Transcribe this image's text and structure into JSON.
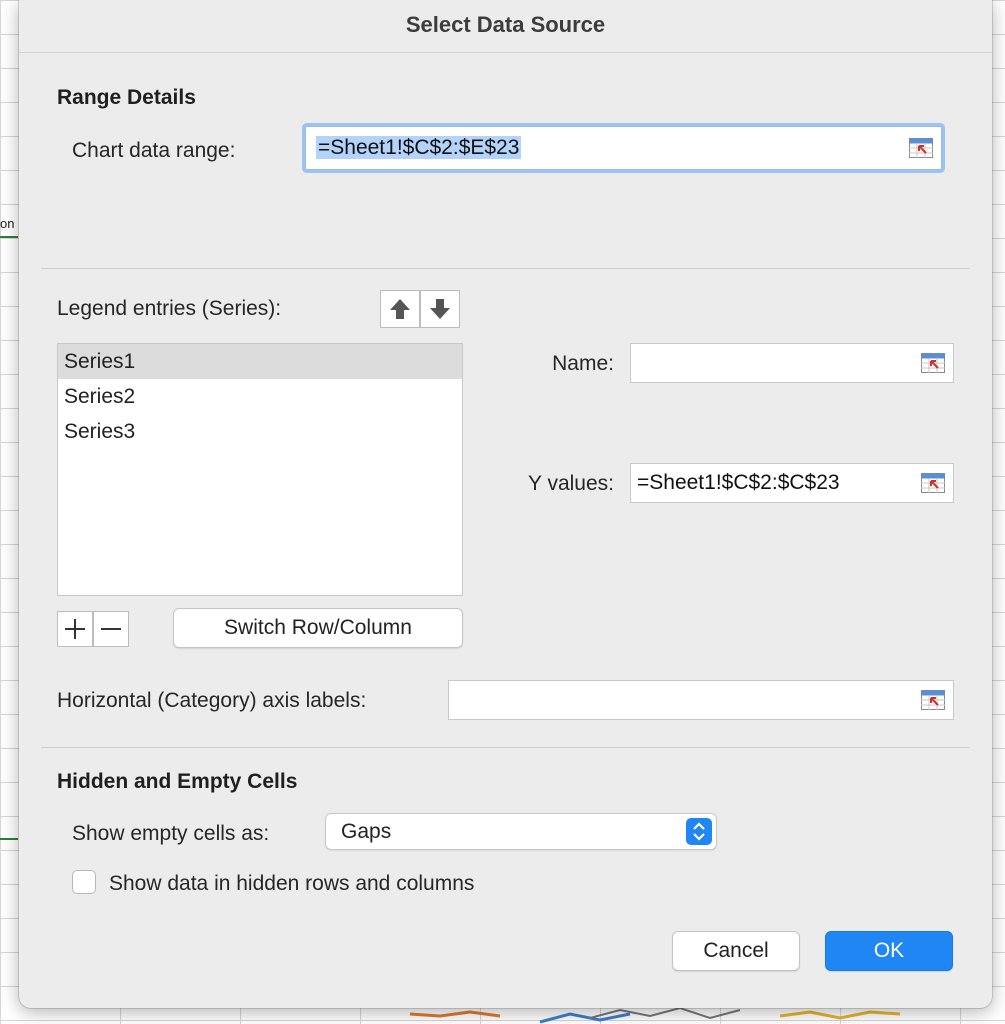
{
  "dialog": {
    "title": "Select Data Source"
  },
  "range_details": {
    "heading": "Range Details",
    "chart_data_range_label": "Chart data range:",
    "chart_data_range_value": "=Sheet1!$C$2:$E$23"
  },
  "legend": {
    "label": "Legend entries (Series):",
    "series": [
      "Series1",
      "Series2",
      "Series3"
    ],
    "selected_index": 0,
    "move_up_icon": "arrow-up-icon",
    "move_down_icon": "arrow-down-icon",
    "add_icon": "plus-icon",
    "remove_icon": "minus-icon",
    "switch_button": "Switch Row/Column"
  },
  "series_detail": {
    "name_label": "Name:",
    "name_value": "",
    "y_values_label": "Y values:",
    "y_values_value": "=Sheet1!$C$2:$C$23"
  },
  "category_axis": {
    "label": "Horizontal (Category) axis labels:",
    "value": ""
  },
  "hidden_empty": {
    "heading": "Hidden and Empty Cells",
    "show_empty_label": "Show empty cells as:",
    "show_empty_value": "Gaps",
    "show_hidden_label": "Show data in hidden rows and columns",
    "show_hidden_checked": false
  },
  "buttons": {
    "cancel": "Cancel",
    "ok": "OK"
  },
  "background": {
    "cell_text": "on"
  },
  "colors": {
    "accent": "#1f86f3",
    "focus_ring": "#9cc4f0",
    "selection": "#b3d3fb"
  }
}
